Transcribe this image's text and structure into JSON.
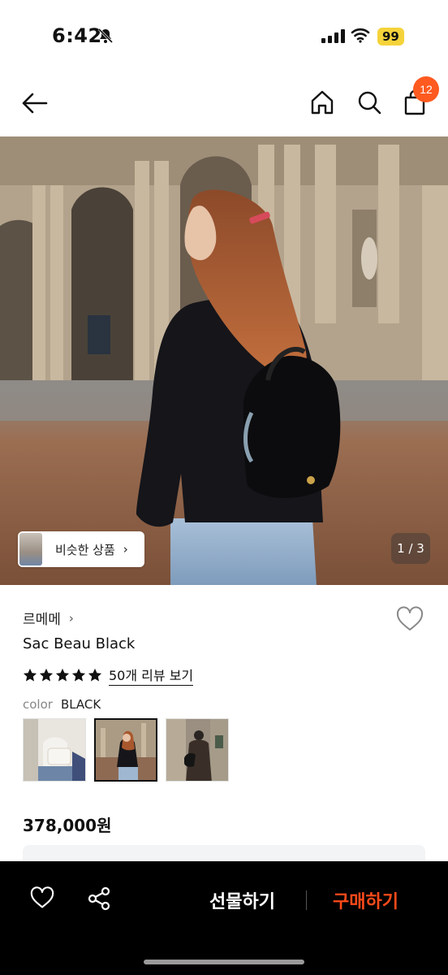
{
  "status_bar": {
    "time": "6:42",
    "battery": "99"
  },
  "nav": {
    "cart_count": "12"
  },
  "gallery": {
    "similar_label": "비슷한 상품",
    "chevron": "›",
    "counter": "1 / 3"
  },
  "product": {
    "brand": "르메메",
    "brand_chevron": "›",
    "name": "Sac Beau Black",
    "review_link": "50개 리뷰 보기",
    "rating_stars": 5,
    "color_label": "color",
    "color_value": "BLACK",
    "price": "378,000원"
  },
  "bottom_bar": {
    "gift_label": "선물하기",
    "buy_label": "구매하기"
  },
  "colors": {
    "accent": "#ff4a1f",
    "badge": "#ff5a1f",
    "battery": "#f5d33a"
  },
  "icons": [
    "back-arrow-icon",
    "home-icon",
    "search-icon",
    "shopping-bag-icon",
    "bell-off-icon",
    "heart-icon",
    "star-icon",
    "share-icon"
  ]
}
